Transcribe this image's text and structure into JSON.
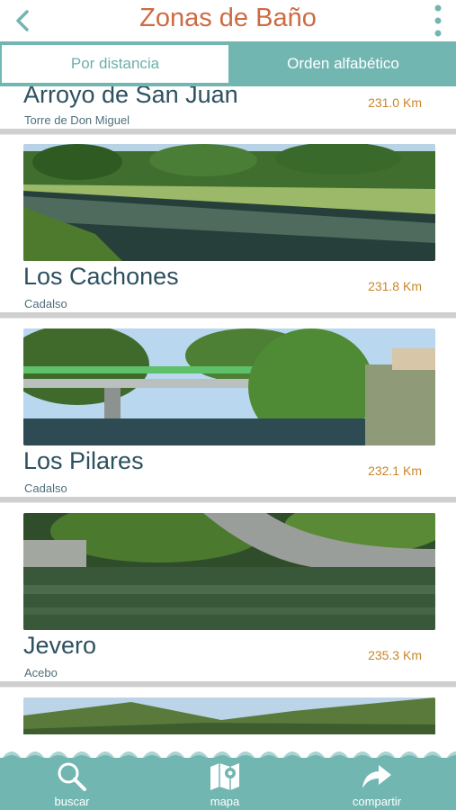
{
  "header": {
    "title": "Zonas de Baño",
    "back_icon": "back-arrow-icon",
    "menu_icon": "more-vert-icon",
    "title_color": "#cd6b43"
  },
  "tabs": [
    {
      "label": "Por distancia",
      "active": true
    },
    {
      "label": "Orden alfabético",
      "active": false
    }
  ],
  "accent_color": "#72b6b2",
  "places": [
    {
      "name": "Arroyo de San Juan",
      "town": "Torre de Don Miguel",
      "distance": "231.0 Km"
    },
    {
      "name": "Los Cachones",
      "town": "Cadalso",
      "distance": "231.8 Km"
    },
    {
      "name": "Los Pilares",
      "town": "Cadalso",
      "distance": "232.1 Km"
    },
    {
      "name": "Jevero",
      "town": "Acebo",
      "distance": "235.3 Km"
    }
  ],
  "footer": {
    "search_label": "buscar",
    "search_icon": "search-icon",
    "map_label": "mapa",
    "map_icon": "map-icon",
    "share_label": "compartir",
    "share_icon": "share-icon"
  }
}
